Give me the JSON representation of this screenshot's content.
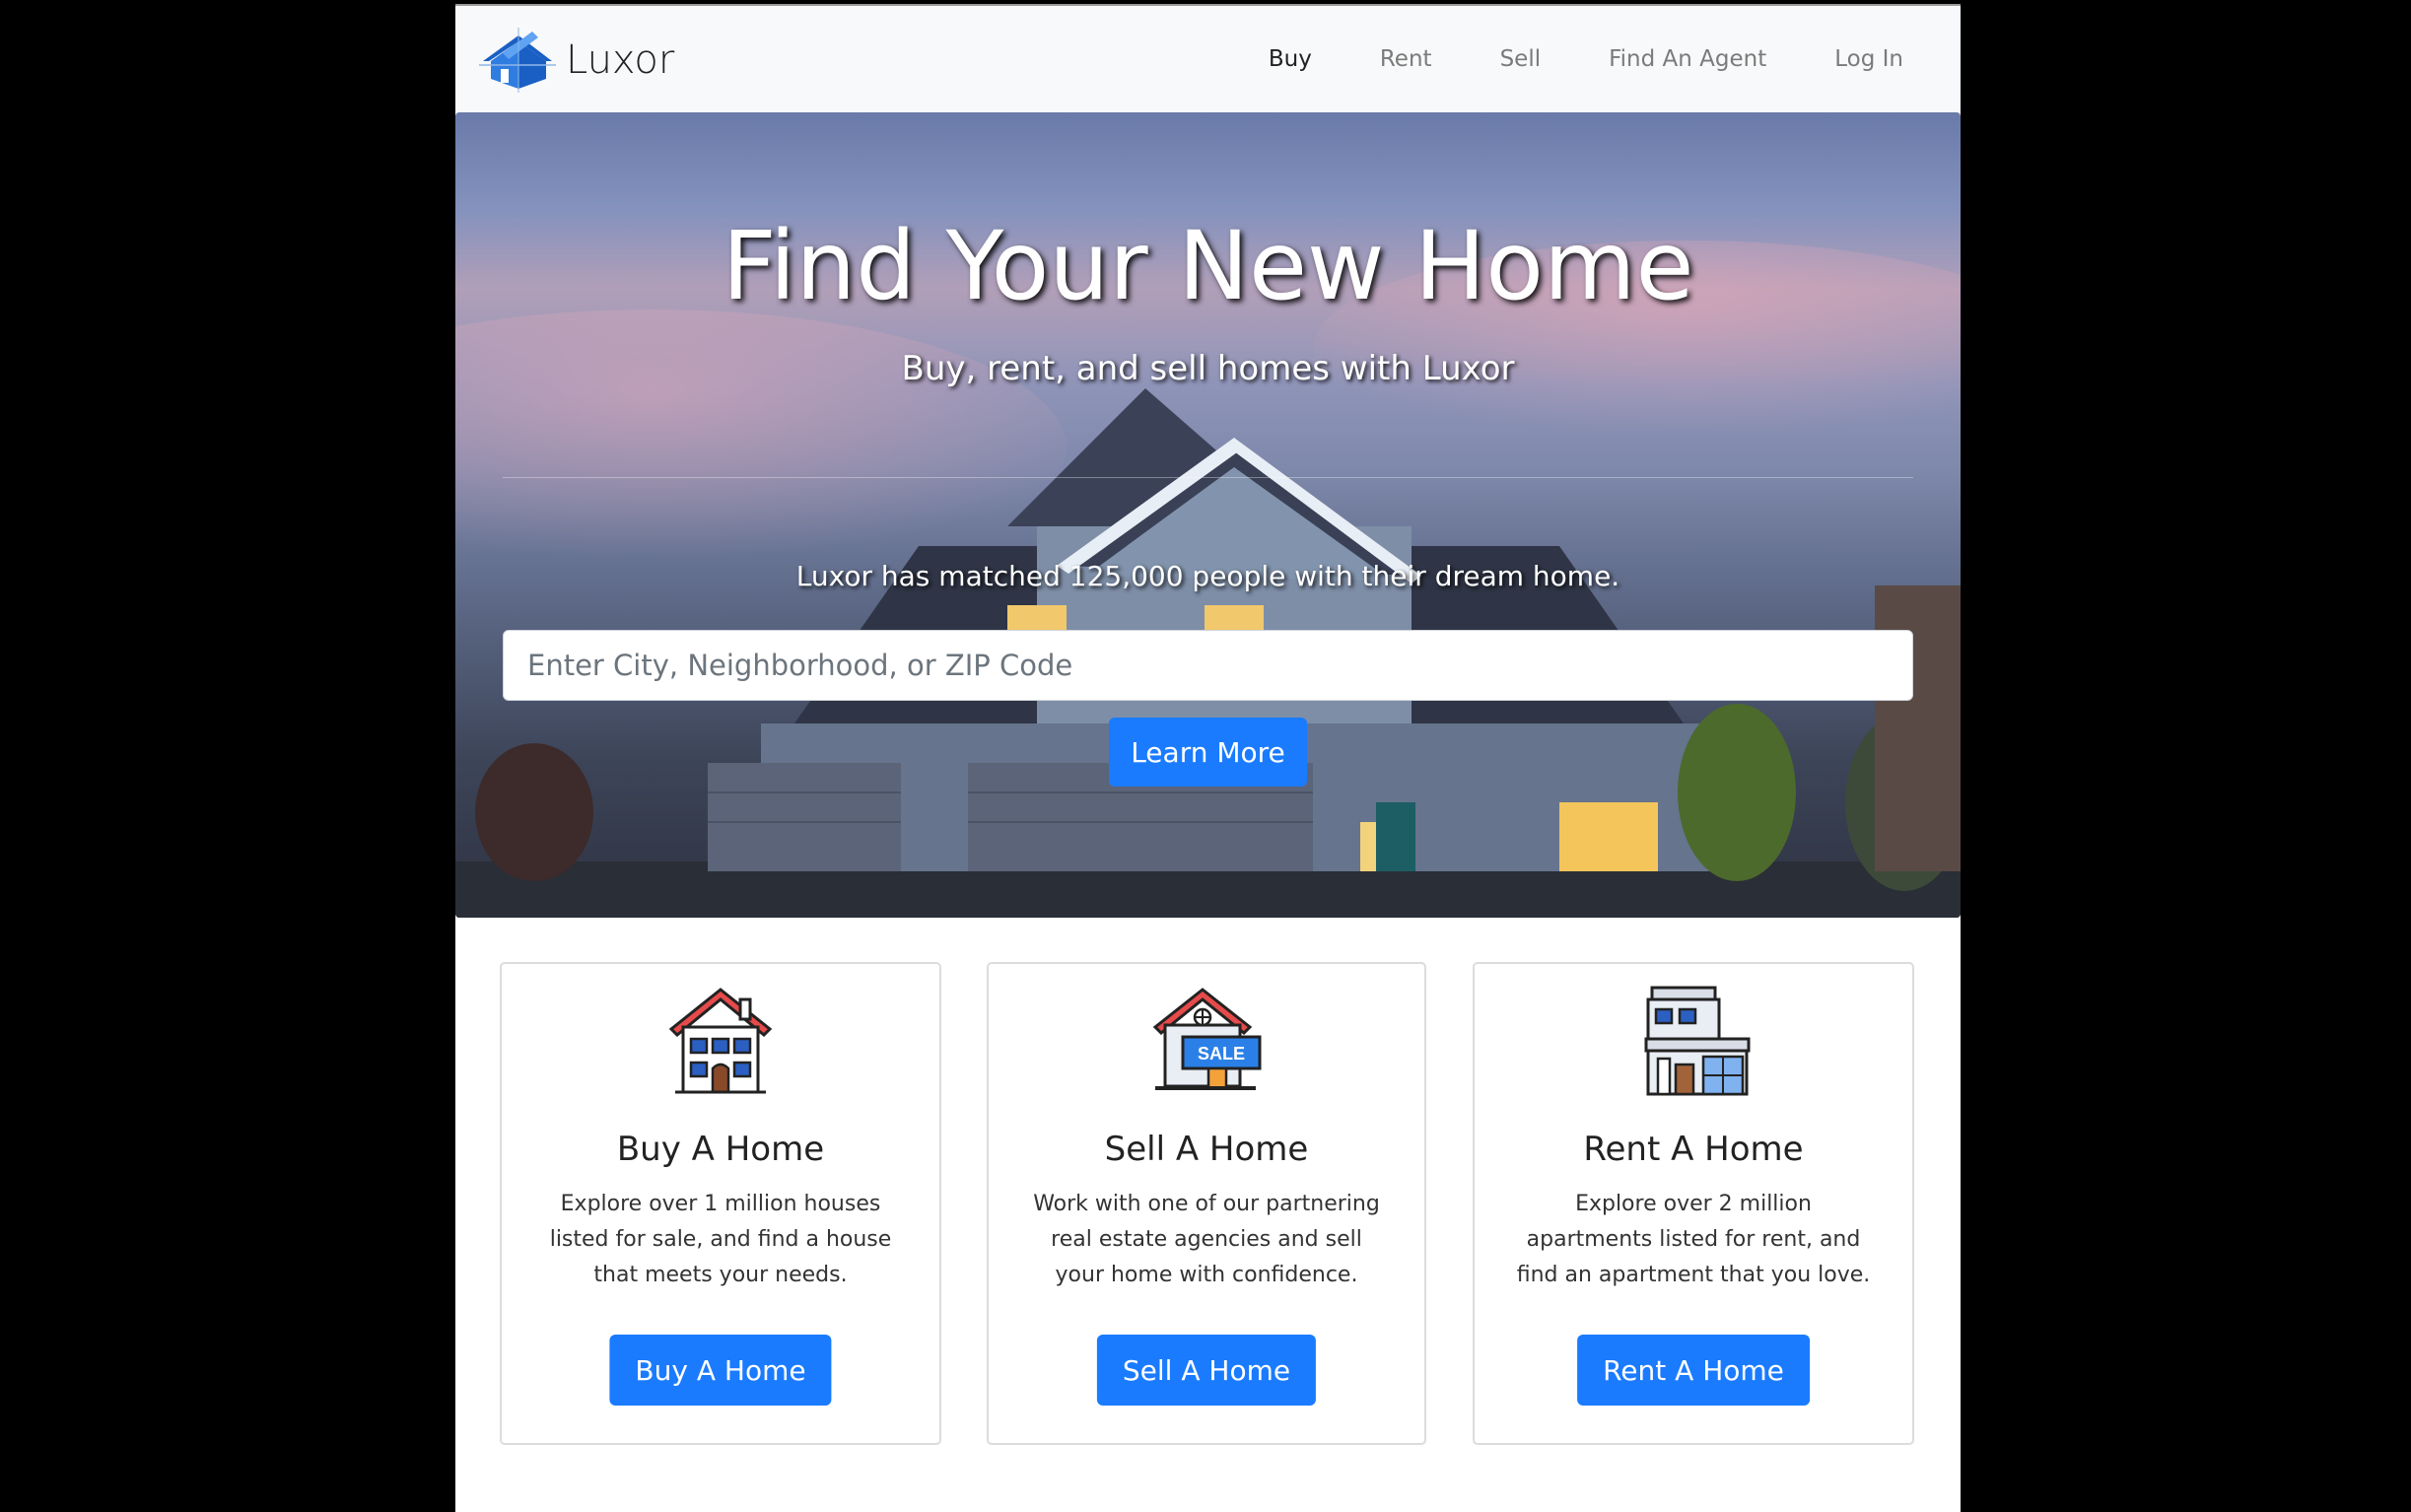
{
  "brand": {
    "name": "Luxor"
  },
  "nav": {
    "items": [
      {
        "label": "Buy",
        "active": true
      },
      {
        "label": "Rent",
        "active": false
      },
      {
        "label": "Sell",
        "active": false
      },
      {
        "label": "Find An Agent",
        "active": false
      },
      {
        "label": "Log In",
        "active": false
      }
    ]
  },
  "hero": {
    "title": "Find Your New Home",
    "subtitle": "Buy, rent, and sell homes with Luxor",
    "lead": "Luxor has matched 125,000 people with their dream home.",
    "search_placeholder": "Enter City, Neighborhood, or ZIP Code",
    "cta_label": "Learn More"
  },
  "cards": [
    {
      "icon": "house-icon",
      "title": "Buy A Home",
      "text": "Explore over 1 million houses listed for sale, and find a house that meets your needs.",
      "button": "Buy A Home"
    },
    {
      "icon": "sale-house-icon",
      "title": "Sell A Home",
      "text": "Work with one of our partnering real estate agencies and sell your home with confidence.",
      "button": "Sell A Home",
      "icon_badge": "SALE"
    },
    {
      "icon": "apartment-building-icon",
      "title": "Rent A Home",
      "text": "Explore over 2 million apartments listed for rent, and find an apartment that you love.",
      "button": "Rent A Home"
    }
  ],
  "colors": {
    "primary": "#1a7bff",
    "navbar_bg": "#f8f9fa",
    "page_bg": "#000000"
  }
}
